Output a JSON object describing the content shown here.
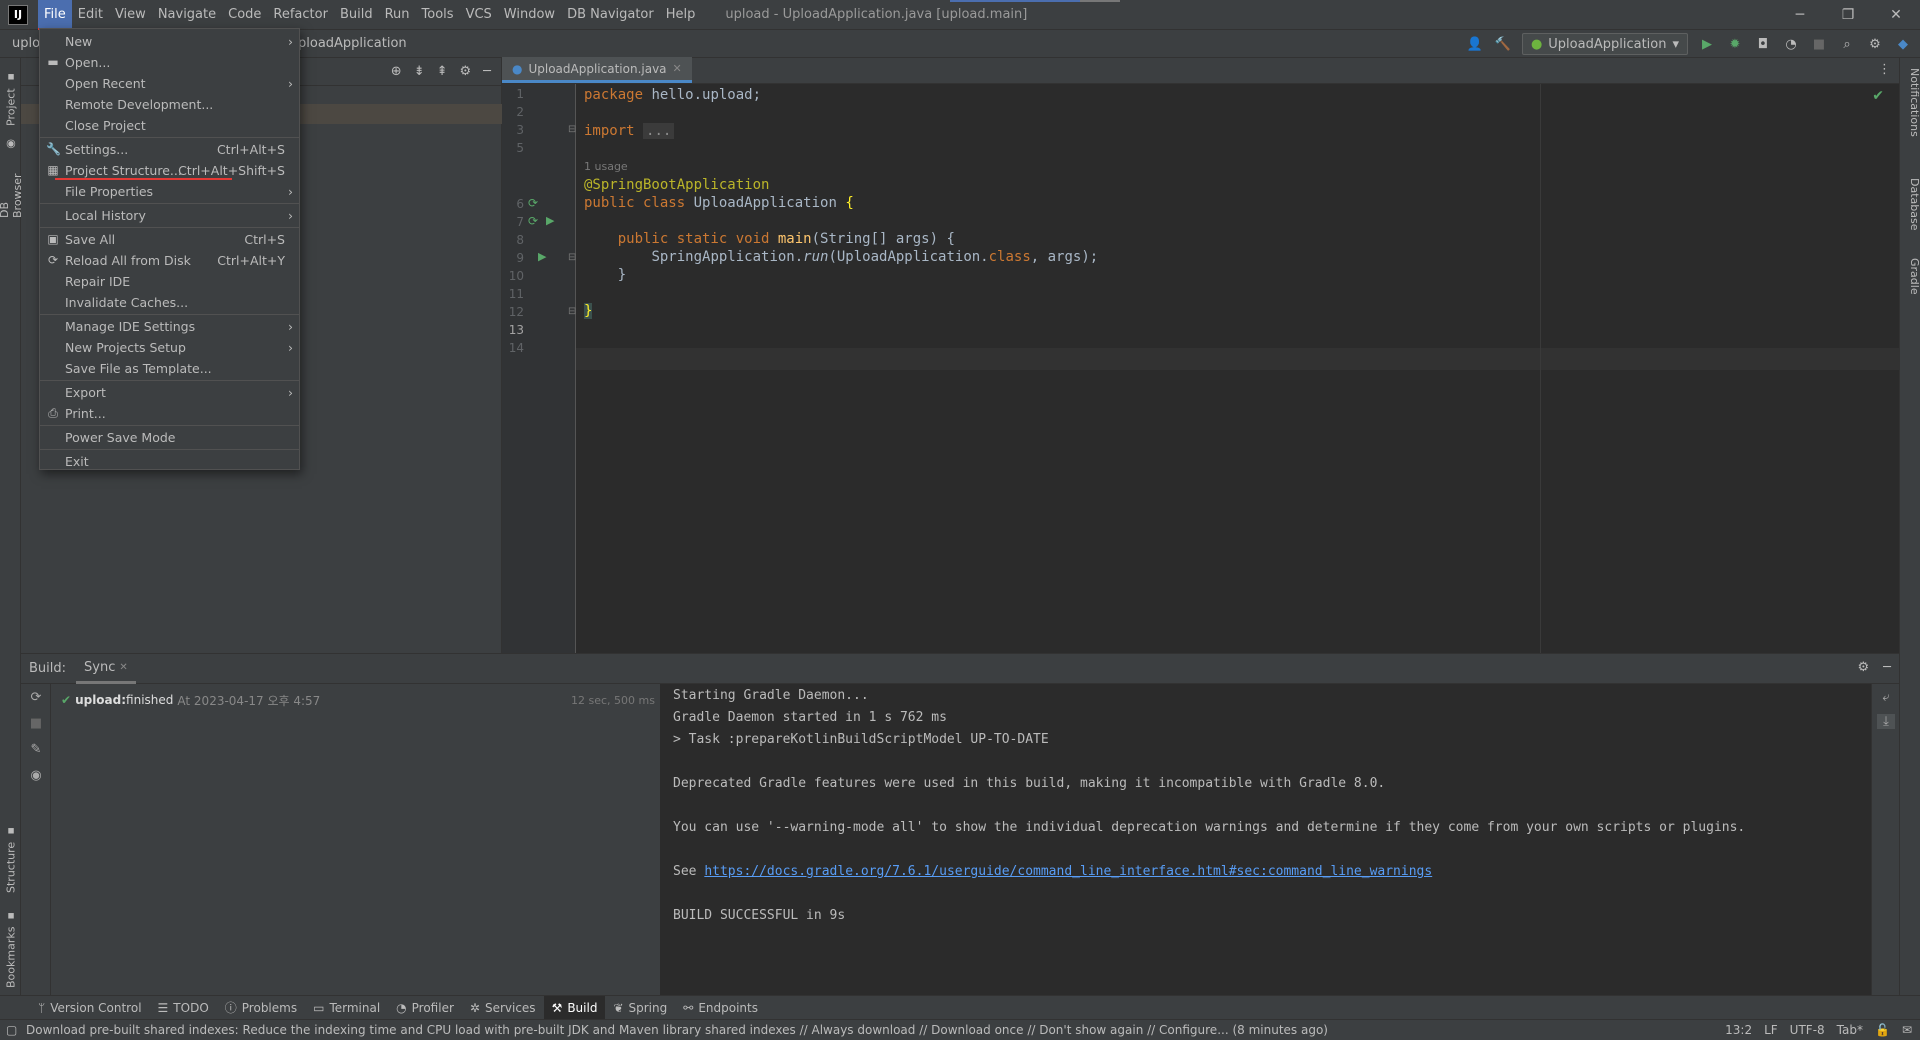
{
  "titlebar": {
    "menus": [
      "File",
      "Edit",
      "View",
      "Navigate",
      "Code",
      "Refactor",
      "Build",
      "Run",
      "Tools",
      "VCS",
      "Window",
      "DB Navigator",
      "Help"
    ],
    "window_title": "upload - UploadApplication.java [upload.main]"
  },
  "navbar": {
    "breadcrumb_left": "uplo",
    "breadcrumb_right": "ploadApplication",
    "run_config": "UploadApplication"
  },
  "left_tabs": {
    "project": "Project",
    "db_browser": "DB Browser",
    "structure": "Structure",
    "bookmarks": "Bookmarks"
  },
  "right_tabs": {
    "notifications": "Notifications",
    "database": "Database",
    "gradle": "Gradle"
  },
  "file_menu": {
    "items": [
      {
        "label": "New",
        "shortcut": "",
        "submenu": true
      },
      {
        "label": "Open...",
        "shortcut": "",
        "submenu": false
      },
      {
        "label": "Open Recent",
        "shortcut": "",
        "submenu": true
      },
      {
        "label": "Remote Development...",
        "shortcut": "",
        "submenu": false
      },
      {
        "label": "Close Project",
        "shortcut": "",
        "submenu": false
      },
      {
        "label": "Settings...",
        "shortcut": "Ctrl+Alt+S",
        "submenu": false
      },
      {
        "label": "Project Structure...",
        "shortcut": "Ctrl+Alt+Shift+S",
        "submenu": false
      },
      {
        "label": "File Properties",
        "shortcut": "",
        "submenu": true
      },
      {
        "label": "Local History",
        "shortcut": "",
        "submenu": true
      },
      {
        "label": "Save All",
        "shortcut": "Ctrl+S",
        "submenu": false
      },
      {
        "label": "Reload All from Disk",
        "shortcut": "Ctrl+Alt+Y",
        "submenu": false
      },
      {
        "label": "Repair IDE",
        "shortcut": "",
        "submenu": false
      },
      {
        "label": "Invalidate Caches...",
        "shortcut": "",
        "submenu": false
      },
      {
        "label": "Manage IDE Settings",
        "shortcut": "",
        "submenu": true
      },
      {
        "label": "New Projects Setup",
        "shortcut": "",
        "submenu": true
      },
      {
        "label": "Save File as Template...",
        "shortcut": "",
        "submenu": false
      },
      {
        "label": "Export",
        "shortcut": "",
        "submenu": true
      },
      {
        "label": "Print...",
        "shortcut": "",
        "submenu": false
      },
      {
        "label": "Power Save Mode",
        "shortcut": "",
        "submenu": false
      },
      {
        "label": "Exit",
        "shortcut": "",
        "submenu": false
      }
    ]
  },
  "editor": {
    "tab_label": "UploadApplication.java",
    "line_numbers": [
      "1",
      "2",
      "3",
      "5",
      "6",
      "7",
      "8",
      "9",
      "10",
      "11",
      "12",
      "13",
      "14"
    ],
    "usage_hint": "1 usage",
    "code": {
      "l1_kw": "package",
      "l1_rest": " hello.upload;",
      "l3_kw": "import",
      "l3_fold": "...",
      "l6_ann": "@SpringBootApplication",
      "l7_kw": "public class",
      "l7_rest": " UploadApplication ",
      "l7_brace": "{",
      "l9_kw": "public static void",
      "l9_fn": "main",
      "l9_rest": "(String[] args) {",
      "l10_cls": "SpringApplication.",
      "l10_run": "run",
      "l10_arg": "(UploadApplication.",
      "l10_kw": "class",
      "l10_end": ", args);",
      "l11": "}",
      "l13": "}"
    }
  },
  "build": {
    "label": "Build:",
    "sync_tab": "Sync",
    "task_name": "upload:",
    "task_status": " finished",
    "task_time": "At 2023-04-17 오후 4:57",
    "duration": "12 sec, 500 ms",
    "console": [
      "Starting Gradle Daemon...",
      "Gradle Daemon started in 1 s 762 ms",
      "> Task :prepareKotlinBuildScriptModel UP-TO-DATE",
      "Deprecated Gradle features were used in this build, making it incompatible with Gradle 8.0.",
      "You can use '--warning-mode all' to show the individual deprecation warnings and determine if they come from your own scripts or plugins.",
      "See ",
      "BUILD SUCCESSFUL in 9s"
    ],
    "console_link": "https://docs.gradle.org/7.6.1/userguide/command_line_interface.html#sec:command_line_warnings"
  },
  "tool_windows": [
    "Version Control",
    "TODO",
    "Problems",
    "Terminal",
    "Profiler",
    "Services",
    "Build",
    "Spring",
    "Endpoints"
  ],
  "status": {
    "message": "Download pre-built shared indexes: Reduce the indexing time and CPU load with pre-built JDK and Maven library shared indexes // Always download // Download once // Don't show again // Configure... (8 minutes ago)",
    "position": "13:2",
    "line_sep": "LF",
    "encoding": "UTF-8",
    "indent": "Tab*"
  },
  "colors": {
    "accent": "#4b6eaf",
    "highlight_underline": "#e53935",
    "success": "#59a869"
  }
}
